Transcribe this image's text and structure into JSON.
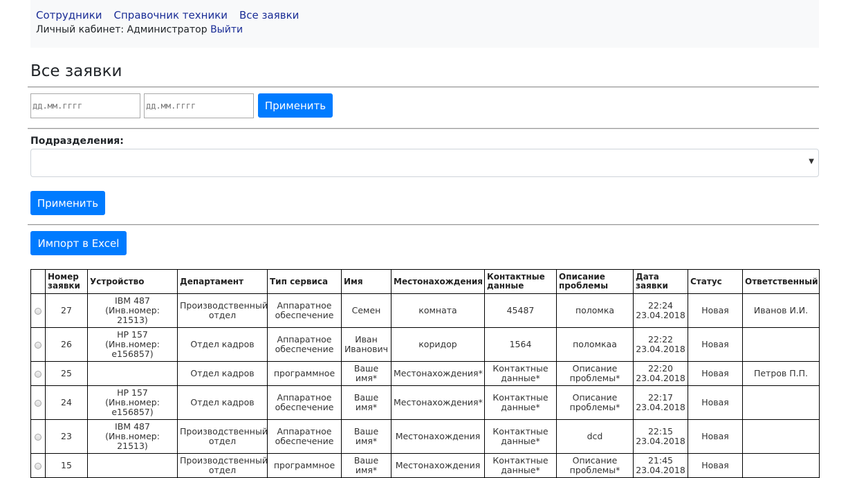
{
  "nav": {
    "links": [
      "Сотрудники",
      "Справочник техники",
      "Все заявки"
    ],
    "cabinet_label": "Личный кабинет: Администратор",
    "logout": "Выйти"
  },
  "page_title": "Все заявки",
  "filters": {
    "date_from_placeholder": "дд.мм.гггг",
    "date_to_placeholder": "дд.мм.гггг",
    "apply_dates": "Применить",
    "department_label": "Подразделения:",
    "department_value": "",
    "apply_department": "Применить",
    "import_excel": "Импорт в Excel"
  },
  "table": {
    "headers": {
      "number": "Номер заявки",
      "device": "Устройство",
      "department": "Департамент",
      "service": "Тип сервиса",
      "name": "Имя",
      "location": "Местонахождения",
      "contacts": "Контактные данные",
      "problem": "Описание проблемы",
      "date": "Дата заявки",
      "status": "Статус",
      "responsible": "Ответственный"
    },
    "rows": [
      {
        "number": "27",
        "device": "IBM 487 (Инв.номер: 21513)",
        "department": "Производственный отдел",
        "service": "Аппаратное обеспечение",
        "name": "Семен",
        "location": "комната",
        "contacts": "45487",
        "problem": "поломка",
        "date": "22:24 23.04.2018",
        "status": "Новая",
        "responsible": "Иванов И.И."
      },
      {
        "number": "26",
        "device": "HP 157 (Инв.номер: e156857)",
        "department": "Отдел кадров",
        "service": "Аппаратное обеспечение",
        "name": "Иван Иванович",
        "location": "коридор",
        "contacts": "1564",
        "problem": "поломкаа",
        "date": "22:22 23.04.2018",
        "status": "Новая",
        "responsible": ""
      },
      {
        "number": "25",
        "device": "",
        "department": "Отдел кадров",
        "service": "программное",
        "name": "Ваше имя*",
        "location": "Местонахождения*",
        "contacts": "Контактные данные*",
        "problem": "Описание проблемы*",
        "date": "22:20 23.04.2018",
        "status": "Новая",
        "responsible": "Петров П.П."
      },
      {
        "number": "24",
        "device": "HP 157 (Инв.номер: e156857)",
        "department": "Отдел кадров",
        "service": "Аппаратное обеспечение",
        "name": "Ваше имя*",
        "location": "Местонахождения*",
        "contacts": "Контактные данные*",
        "problem": "Описание проблемы*",
        "date": "22:17 23.04.2018",
        "status": "Новая",
        "responsible": ""
      },
      {
        "number": "23",
        "device": "IBM 487 (Инв.номер: 21513)",
        "department": "Производственный отдел",
        "service": "Аппаратное обеспечение",
        "name": "Ваше имя*",
        "location": "Местонахождения",
        "contacts": "Контактные данные*",
        "problem": "dcd",
        "date": "22:15 23.04.2018",
        "status": "Новая",
        "responsible": ""
      },
      {
        "number": "15",
        "device": "",
        "department": "Производственный отдел",
        "service": "программное",
        "name": "Ваше имя*",
        "location": "Местонахождения",
        "contacts": "Контактные данные*",
        "problem": "Описание проблемы*",
        "date": "21:45 23.04.2018",
        "status": "Новая",
        "responsible": ""
      }
    ]
  }
}
